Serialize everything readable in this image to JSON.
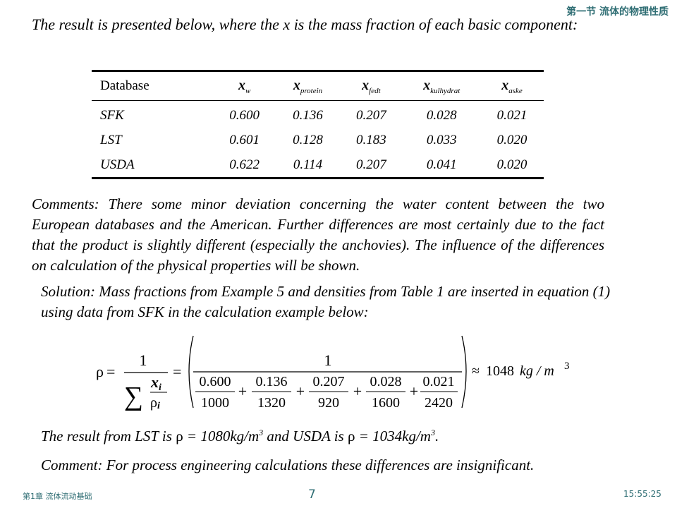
{
  "header": {
    "section_title": "第一节 流体的物理性质"
  },
  "intro": {
    "text": "The result is presented below, where the x is the mass fraction of each basic component:"
  },
  "table": {
    "headers": [
      {
        "label": "Database"
      },
      {
        "base": "x",
        "sub": "w"
      },
      {
        "base": "x",
        "sub": "protein"
      },
      {
        "base": "x",
        "sub": "fedt"
      },
      {
        "base": "x",
        "sub": "kulhydrat"
      },
      {
        "base": "x",
        "sub": "aske"
      }
    ],
    "rows": [
      [
        "SFK",
        "0.600",
        "0.136",
        "0.207",
        "0.028",
        "0.021"
      ],
      [
        "LST",
        "0.601",
        "0.128",
        "0.183",
        "0.033",
        "0.020"
      ],
      [
        "USDA",
        "0.622",
        "0.114",
        "0.207",
        "0.041",
        "0.020"
      ]
    ]
  },
  "comments": {
    "text": "Comments: There some minor deviation concerning the water content between the two European databases and the American. Further differences are most certainly due to the fact that the product is slightly different (especially the anchovies). The influence of the differences on calculation of the physical properties will be shown."
  },
  "solution": {
    "text": "Solution: Mass fractions from Example 5 and densities from Table 1 are inserted in equation (1) using data from SFK in the calculation example below:"
  },
  "formula": {
    "rho": "ρ",
    "equals": "=",
    "one": "1",
    "sigma": "∑",
    "xi": "x",
    "rhoi": "ρ",
    "sub_i": "i",
    "fractions": [
      {
        "num": "0.600",
        "den": "1000"
      },
      {
        "num": "0.136",
        "den": "1320"
      },
      {
        "num": "0.207",
        "den": "920"
      },
      {
        "num": "0.028",
        "den": "1600"
      },
      {
        "num": "0.021",
        "den": "2420"
      }
    ],
    "plus": "+",
    "approx": "≈",
    "result_value": "1048",
    "result_unit": "kg / m",
    "result_exp": "3"
  },
  "results_line": {
    "prefix": "The result from LST is ",
    "rho1": "ρ",
    "value1": " = 1080kg/m",
    "exp": "3",
    "middle": " and USDA is ",
    "rho2": "ρ",
    "value2": " = 1034kg/m",
    "suffix": "."
  },
  "comment2": {
    "text": "Comment: For process engineering calculations these differences are insignificant."
  },
  "footer": {
    "chapter": "第1章 流体流动基础",
    "page_number": "7",
    "time": "15:55:25"
  },
  "colors": {
    "accent": "#2e6d73",
    "text": "#000000"
  }
}
